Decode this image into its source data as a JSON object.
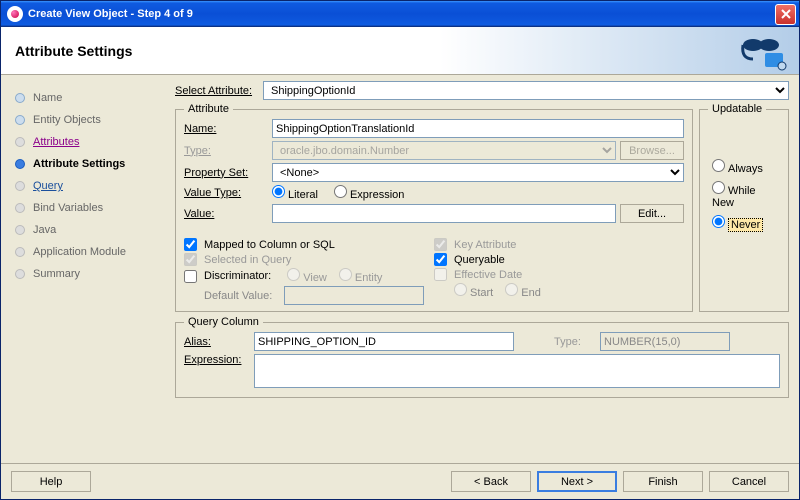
{
  "titlebar": {
    "title": "Create View Object - Step 4 of 9"
  },
  "header": {
    "title": "Attribute Settings"
  },
  "sidebar": {
    "items": [
      {
        "label": "Name"
      },
      {
        "label": "Entity Objects"
      },
      {
        "label": "Attributes"
      },
      {
        "label": "Attribute Settings"
      },
      {
        "label": "Query"
      },
      {
        "label": "Bind Variables"
      },
      {
        "label": "Java"
      },
      {
        "label": "Application Module"
      },
      {
        "label": "Summary"
      }
    ]
  },
  "content": {
    "select_attr_label": "Select Attribute:",
    "select_attr_value": "ShippingOptionId",
    "attribute_legend": "Attribute",
    "name_label": "Name:",
    "name_value": "ShippingOptionTranslationId",
    "type_label": "Type:",
    "type_value": "oracle.jbo.domain.Number",
    "browse_btn": "Browse...",
    "prop_set_label": "Property Set:",
    "prop_set_value": "<None>",
    "value_type_label": "Value Type:",
    "literal": "Literal",
    "expression": "Expression",
    "value_label": "Value:",
    "edit_btn": "Edit...",
    "mapped": "Mapped to Column or SQL",
    "selected_in_query": "Selected in Query",
    "discriminator": "Discriminator:",
    "view": "View",
    "entity": "Entity",
    "default_value": "Default Value:",
    "key_attr": "Key Attribute",
    "queryable": "Queryable",
    "eff_date": "Effective Date",
    "start": "Start",
    "end": "End",
    "updatable_legend": "Updatable",
    "always": "Always",
    "while_new": "While New",
    "never": "Never",
    "qc_legend": "Query Column",
    "alias_label": "Alias:",
    "alias_value": "SHIPPING_OPTION_ID",
    "qc_type_label": "Type:",
    "qc_type_value": "NUMBER(15,0)",
    "expr_label": "Expression:"
  },
  "footer": {
    "help": "Help",
    "back": "< Back",
    "next": "Next >",
    "finish": "Finish",
    "cancel": "Cancel"
  }
}
